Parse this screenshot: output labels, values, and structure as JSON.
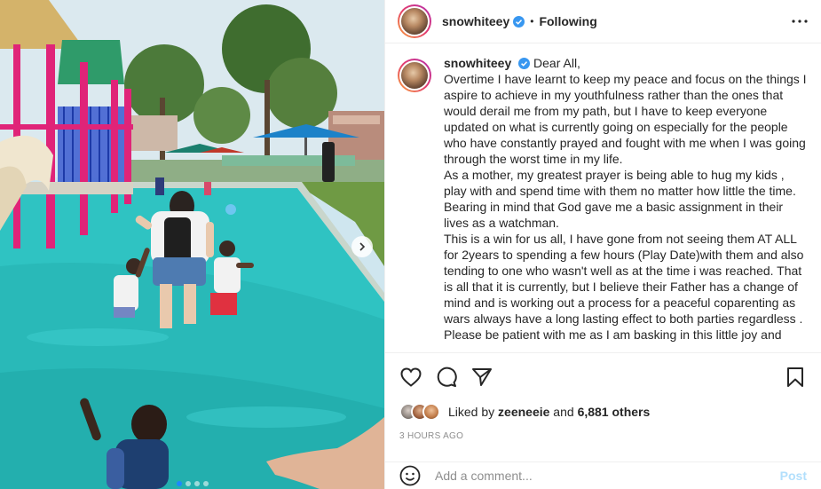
{
  "post": {
    "username": "snowhiteey",
    "separator": "•",
    "follow_status": "Following",
    "caption_paragraphs": [
      "Dear All,",
      "Overtime I have learnt to keep my peace and focus on the things I aspire to achieve in my youthfulness rather than the ones that would derail me from my path, but I have to keep everyone updated on what is currently going on especially for the people who have constantly prayed and fought with me when I was going through the worst time in my life.",
      "As a mother, my greatest prayer is being able to hug my kids , play with and spend time with them no matter how little the time. Bearing in mind that God gave me a basic assignment in their lives as a watchman.",
      "This is a win for us all, I have gone from not seeing them AT ALL for 2years to spending a few hours (Play Date)with them and also tending to one who wasn't well as at the time i was reached. That is all that it is currently, but I believe their Father has a change of mind and is working out a process for a peaceful coparenting as wars always have a long lasting effect to both parties regardless .",
      "Please be patient with me as I am basking in this little joy and"
    ],
    "likes": {
      "prefix": "Liked by ",
      "user": "zeeneeie",
      "middle": " and ",
      "others": "6,881 others"
    },
    "timestamp": "3 HOURS AGO",
    "comment_placeholder": "Add a comment...",
    "post_label": "Post",
    "carousel": {
      "slides": 4,
      "active_index": 0
    }
  },
  "icons": {
    "verified": "verified-badge-icon",
    "more": "more-options-icon",
    "like": "heart-icon",
    "comment": "comment-icon",
    "share": "share-icon",
    "save": "bookmark-icon",
    "emoji": "emoji-icon",
    "next": "chevron-right-icon"
  },
  "colors": {
    "verified": "#3897f0",
    "post_button": "#b2dffc",
    "muted": "#8e8e8e",
    "carousel_active": "#1e88ff"
  }
}
